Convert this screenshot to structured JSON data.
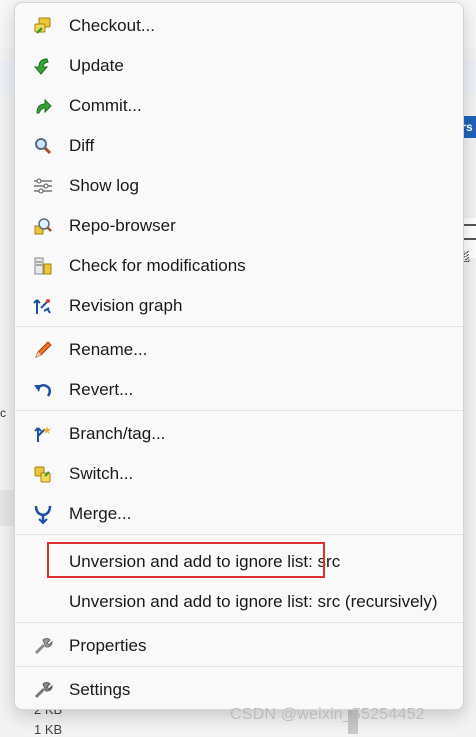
{
  "menu": {
    "items": [
      {
        "label": "Checkout...",
        "icon": "checkout-icon"
      },
      {
        "label": "Update",
        "icon": "update-icon"
      },
      {
        "label": "Commit...",
        "icon": "commit-icon"
      },
      {
        "label": "Diff",
        "icon": "diff-icon"
      },
      {
        "label": "Show log",
        "icon": "show-log-icon"
      },
      {
        "label": "Repo-browser",
        "icon": "repo-browser-icon"
      },
      {
        "label": "Check for modifications",
        "icon": "check-modifications-icon"
      },
      {
        "label": "Revision graph",
        "icon": "revision-graph-icon"
      },
      {
        "label": "Rename...",
        "icon": "rename-icon"
      },
      {
        "label": "Revert...",
        "icon": "revert-icon"
      },
      {
        "label": "Branch/tag...",
        "icon": "branch-tag-icon"
      },
      {
        "label": "Switch...",
        "icon": "switch-icon"
      },
      {
        "label": "Merge...",
        "icon": "merge-icon"
      },
      {
        "label": "Unversion and add to ignore list: src"
      },
      {
        "label": "Unversion and add to ignore list: src (recursively)"
      },
      {
        "label": "Properties",
        "icon": "properties-icon"
      },
      {
        "label": "Settings",
        "icon": "settings-icon"
      }
    ]
  },
  "background": {
    "right_badge": "rs",
    "right_char": "彪",
    "left_char": "c",
    "size_labels": [
      "2 KB",
      "1 KB"
    ]
  },
  "watermark": "CSDN @weixin_55254452",
  "colors": {
    "highlight_border": "#d93030",
    "menu_background": "#f9f9f9"
  }
}
